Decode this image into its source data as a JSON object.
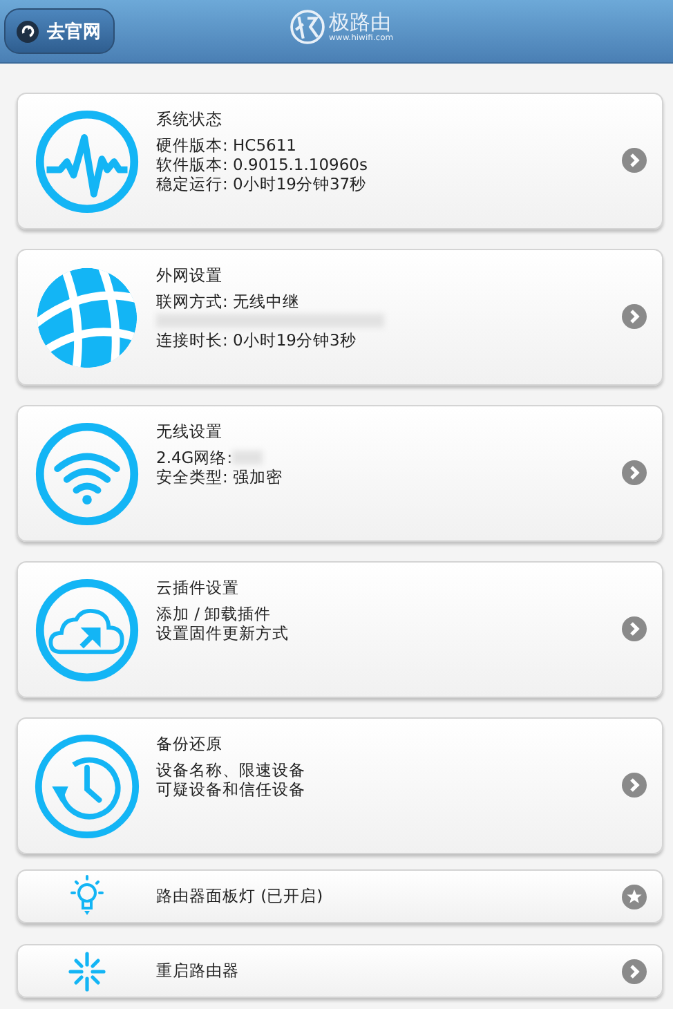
{
  "header": {
    "back_button": "去官网",
    "logo_name": "极路由",
    "logo_url": "www.hiwifi.com"
  },
  "cards": [
    {
      "title": "系统状态",
      "lines": [
        {
          "kind": "text",
          "text": "硬件版本: HC5611"
        },
        {
          "kind": "text",
          "text": "软件版本: 0.9015.1.10960s"
        },
        {
          "kind": "text",
          "text": "稳定运行: 0小时19分钟37秒"
        }
      ]
    },
    {
      "title": "外网设置",
      "lines": [
        {
          "kind": "text",
          "text": "联网方式: 无线中继"
        },
        {
          "kind": "redacted"
        },
        {
          "kind": "text",
          "text": "连接时长: 0小时19分钟3秒"
        }
      ]
    },
    {
      "title": "无线设置",
      "lines": [
        {
          "kind": "text_redacted",
          "text": "2.4G网络:"
        },
        {
          "kind": "text",
          "text": "安全类型: 强加密"
        }
      ]
    },
    {
      "title": "云插件设置",
      "lines": [
        {
          "kind": "text",
          "text": "添加 / 卸载插件"
        },
        {
          "kind": "text",
          "text": "设置固件更新方式"
        }
      ]
    },
    {
      "title": "备份还原",
      "lines": [
        {
          "kind": "text",
          "text": "设备名称、限速设备"
        },
        {
          "kind": "text",
          "text": "可疑设备和信任设备"
        }
      ]
    }
  ],
  "rows": [
    {
      "label": "路由器面板灯 (已开启)"
    },
    {
      "label": "重启路由器"
    }
  ]
}
